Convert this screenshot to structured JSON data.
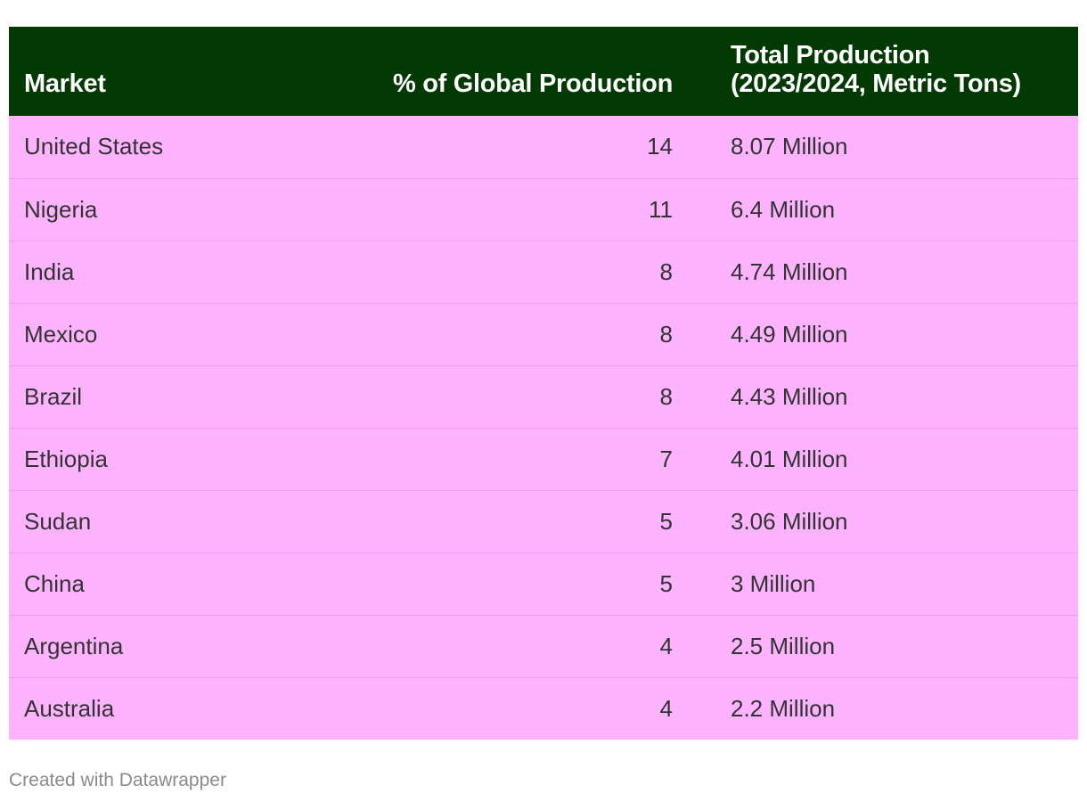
{
  "chart_data": {
    "type": "table",
    "columns": [
      "Market",
      "% of Global Production",
      "Total Production\n(2023/2024, Metric Tons)"
    ],
    "rows": [
      {
        "market": "United States",
        "pct": "14",
        "total": "8.07 Million"
      },
      {
        "market": "Nigeria",
        "pct": "11",
        "total": "6.4 Million"
      },
      {
        "market": "India",
        "pct": "8",
        "total": "4.74 Million"
      },
      {
        "market": "Mexico",
        "pct": "8",
        "total": "4.49 Million"
      },
      {
        "market": "Brazil",
        "pct": "8",
        "total": "4.43 Million"
      },
      {
        "market": "Ethiopia",
        "pct": "7",
        "total": "4.01 Million"
      },
      {
        "market": "Sudan",
        "pct": "5",
        "total": "3.06 Million"
      },
      {
        "market": "China",
        "pct": "5",
        "total": "3 Million"
      },
      {
        "market": "Argentina",
        "pct": "4",
        "total": "2.5 Million"
      },
      {
        "market": "Australia",
        "pct": "4",
        "total": "2.2 Million"
      }
    ],
    "colors": {
      "header_background": "#033a04",
      "header_text": "#ffffff",
      "row_background": "#fdb3fd",
      "row_divider": "#f29af2",
      "body_text": "#333333"
    }
  },
  "footer": {
    "credit": "Created with Datawrapper"
  }
}
